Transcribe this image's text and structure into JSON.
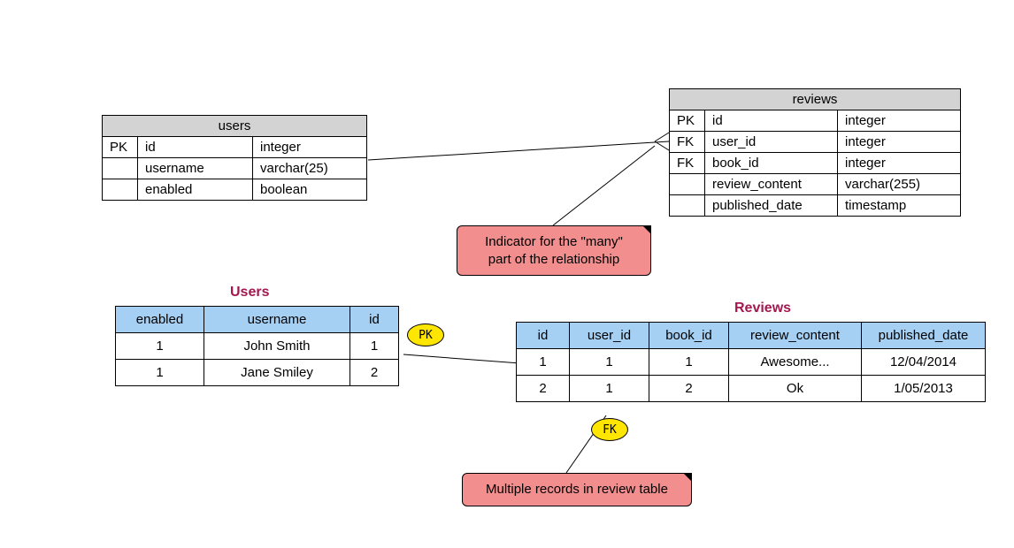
{
  "schema": {
    "users": {
      "title": "users",
      "rows": [
        {
          "key": "PK",
          "name": "id",
          "type": "integer"
        },
        {
          "key": "",
          "name": "username",
          "type": "varchar(25)"
        },
        {
          "key": "",
          "name": "enabled",
          "type": "boolean"
        }
      ]
    },
    "reviews": {
      "title": "reviews",
      "rows": [
        {
          "key": "PK",
          "name": "id",
          "type": "integer"
        },
        {
          "key": "FK",
          "name": "user_id",
          "type": "integer"
        },
        {
          "key": "FK",
          "name": "book_id",
          "type": "integer"
        },
        {
          "key": "",
          "name": "review_content",
          "type": "varchar(255)"
        },
        {
          "key": "",
          "name": "published_date",
          "type": "timestamp"
        }
      ]
    }
  },
  "dataTables": {
    "users": {
      "title": "Users",
      "headers": [
        "enabled",
        "username",
        "id"
      ],
      "rows": [
        [
          "1",
          "John Smith",
          "1"
        ],
        [
          "1",
          "Jane Smiley",
          "2"
        ]
      ]
    },
    "reviews": {
      "title": "Reviews",
      "headers": [
        "id",
        "user_id",
        "book_id",
        "review_content",
        "published_date"
      ],
      "rows": [
        [
          "1",
          "1",
          "1",
          "Awesome...",
          "12/04/2014"
        ],
        [
          "2",
          "1",
          "2",
          "Ok",
          "1/05/2013"
        ]
      ]
    }
  },
  "notes": {
    "many": "Indicator for the \"many\"\npart of the relationship",
    "multiple": "Multiple records in review table"
  },
  "badges": {
    "pk": "PK",
    "fk": "FK"
  }
}
